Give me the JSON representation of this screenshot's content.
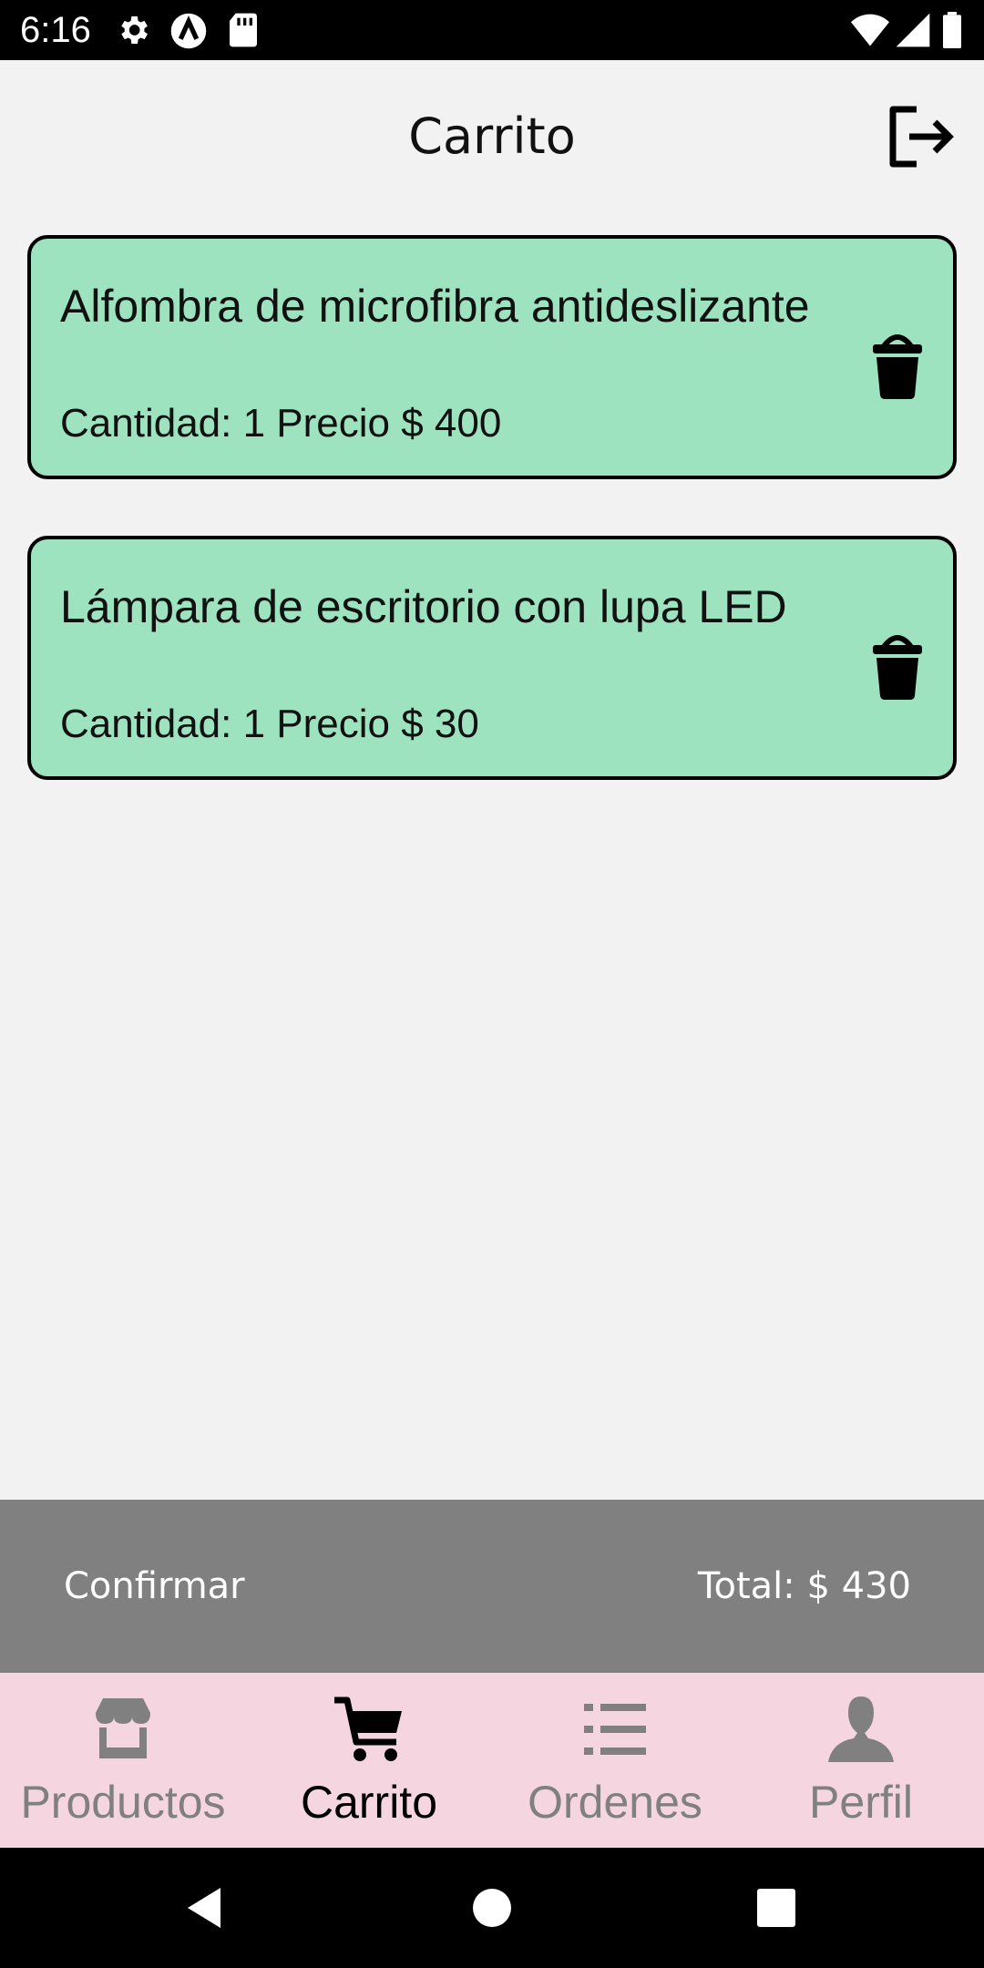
{
  "status_bar": {
    "time": "6:16"
  },
  "header": {
    "title": "Carrito",
    "logout_icon": "logout-icon"
  },
  "cart": {
    "items": [
      {
        "name": "Alfombra de microfibra antideslizante",
        "detail": "Cantidad: 1 Precio $ 400",
        "quantity": 1,
        "price": 400,
        "delete_icon": "trash-icon"
      },
      {
        "name": "Lámpara de escritorio con lupa LED",
        "detail": "Cantidad: 1 Precio $ 30",
        "quantity": 1,
        "price": 30,
        "delete_icon": "trash-icon"
      }
    ],
    "card_color": "#9ee3bf"
  },
  "footer": {
    "confirm_label": "Confirmar",
    "total_label": "Total: $ 430",
    "background": "#808080"
  },
  "bottom_nav": {
    "items": [
      {
        "label": "Productos",
        "icon": "store-icon",
        "active": false
      },
      {
        "label": "Carrito",
        "icon": "cart-icon",
        "active": true
      },
      {
        "label": "Ordenes",
        "icon": "list-icon",
        "active": false
      },
      {
        "label": "Perfil",
        "icon": "person-icon",
        "active": false
      }
    ],
    "background": "#f5d6e0"
  }
}
